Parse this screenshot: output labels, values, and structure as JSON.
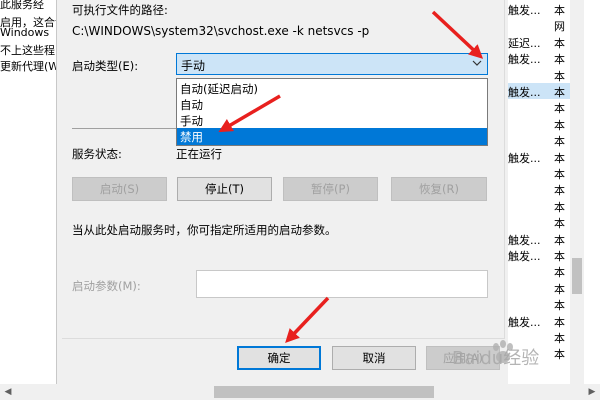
{
  "background_left": {
    "lines": [
      "此服务经",
      "启用，这合计",
      "Windows",
      "不上这些程",
      "更新代理(W"
    ]
  },
  "dialog": {
    "exe_path_label": "可执行文件的路径:",
    "exe_path": "C:\\WINDOWS\\system32\\svchost.exe -k netsvcs -p",
    "startup_type_label": "启动类型(E):",
    "startup_type_value": "手动",
    "startup_options": [
      "自动(延迟启动)",
      "自动",
      "手动",
      "禁用"
    ],
    "selected_option_index": 3,
    "service_status_label": "服务状态:",
    "service_status_value": "正在运行",
    "buttons": {
      "start": "启动(S)",
      "stop": "停止(T)",
      "pause": "暂停(P)",
      "resume": "恢复(R)"
    },
    "hint": "当从此处启动服务时，你可指定所适用的启动参数。",
    "start_params_label": "启动参数(M):",
    "start_params_value": "",
    "footer": {
      "ok": "确定",
      "cancel": "取消",
      "apply": "应用(A)"
    }
  },
  "background_right": {
    "rows": [
      {
        "c1": "触发...",
        "c2": "本"
      },
      {
        "c1": "",
        "c2": "网"
      },
      {
        "c1": "延迟...",
        "c2": "本"
      },
      {
        "c1": "触发...",
        "c2": "本"
      },
      {
        "c1": "",
        "c2": "本"
      },
      {
        "c1": "触发...",
        "c2": "本"
      },
      {
        "c1": "",
        "c2": "本"
      },
      {
        "c1": "",
        "c2": "本"
      },
      {
        "c1": "",
        "c2": "本"
      },
      {
        "c1": "触发...",
        "c2": "本"
      },
      {
        "c1": "",
        "c2": "本"
      },
      {
        "c1": "",
        "c2": "本"
      },
      {
        "c1": "",
        "c2": "本"
      },
      {
        "c1": "",
        "c2": "本"
      },
      {
        "c1": "触发...",
        "c2": "本"
      },
      {
        "c1": "触发...",
        "c2": "本"
      },
      {
        "c1": "",
        "c2": "本"
      },
      {
        "c1": "",
        "c2": "本"
      },
      {
        "c1": "",
        "c2": "本"
      },
      {
        "c1": "触发...",
        "c2": "本"
      },
      {
        "c1": "",
        "c2": "本"
      },
      {
        "c1": "",
        "c2": "本"
      }
    ]
  },
  "watermark": "Baidu经验",
  "colors": {
    "accent": "#0078d7",
    "selection": "#cce4f7",
    "annotation_arrow": "#e8201e"
  }
}
